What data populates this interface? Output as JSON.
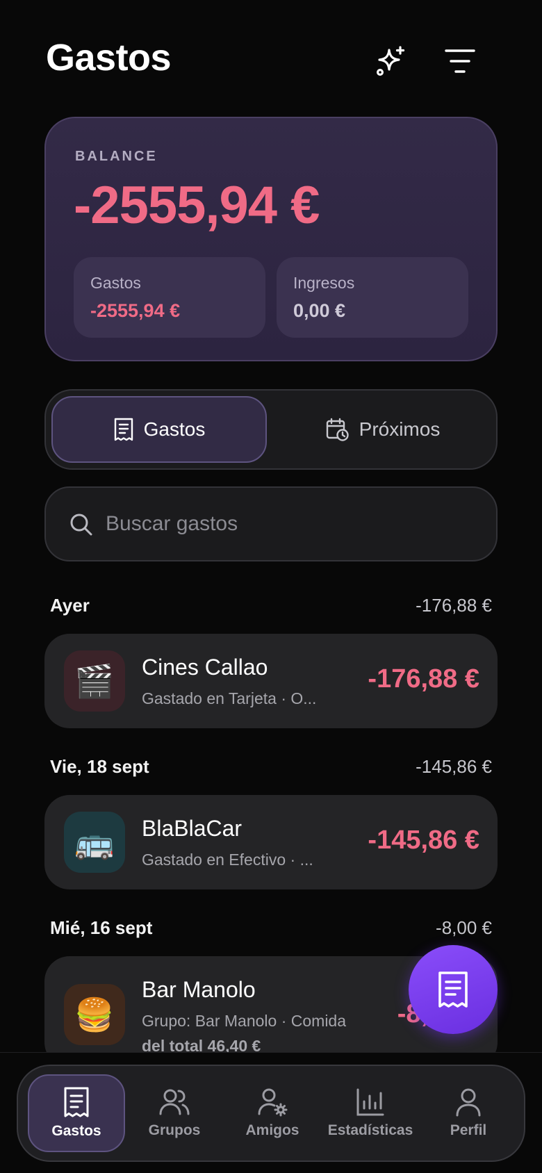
{
  "header": {
    "title": "Gastos"
  },
  "balance": {
    "label": "BALANCE",
    "amount": "-2555,94 €",
    "expenses_label": "Gastos",
    "expenses_value": "-2555,94 €",
    "income_label": "Ingresos",
    "income_value": "0,00 €"
  },
  "segments": {
    "active": "Gastos",
    "inactive": "Próximos"
  },
  "search": {
    "placeholder": "Buscar gastos"
  },
  "groups": [
    {
      "date": "Ayer",
      "total": "-176,88 €",
      "item": {
        "icon": "clapperboard-icon",
        "emoji": "🎬",
        "name": "Cines Callao",
        "subtitle": "Gastado en Tarjeta · O...",
        "amount": "-176,88 €"
      }
    },
    {
      "date": "Vie, 18 sept",
      "total": "-145,86 €",
      "item": {
        "icon": "bus-icon",
        "emoji": "🚌",
        "name": "BlaBlaCar",
        "subtitle": "Gastado en Efectivo · ...",
        "amount": "-145,86 €"
      }
    },
    {
      "date": "Mié, 16 sept",
      "total": "-8,00 €",
      "item": {
        "icon": "burger-icon",
        "emoji": "🍔",
        "name": "Bar Manolo",
        "subtitle": "Grupo: Bar Manolo · Comida",
        "subtitle2": "del total 46,40 €",
        "amount": "-8,00 €"
      }
    }
  ],
  "tabbar": {
    "items": [
      {
        "label": "Gastos",
        "icon": "receipt-icon",
        "active": true
      },
      {
        "label": "Grupos",
        "icon": "users-icon"
      },
      {
        "label": "Amigos",
        "icon": "user-gear-icon"
      },
      {
        "label": "Estadísticas",
        "icon": "bar-chart-icon"
      },
      {
        "label": "Perfil",
        "icon": "user-icon"
      }
    ]
  },
  "colors": {
    "accent": "#8a4dfa",
    "negative": "#f06b86",
    "card": "#332a47"
  }
}
